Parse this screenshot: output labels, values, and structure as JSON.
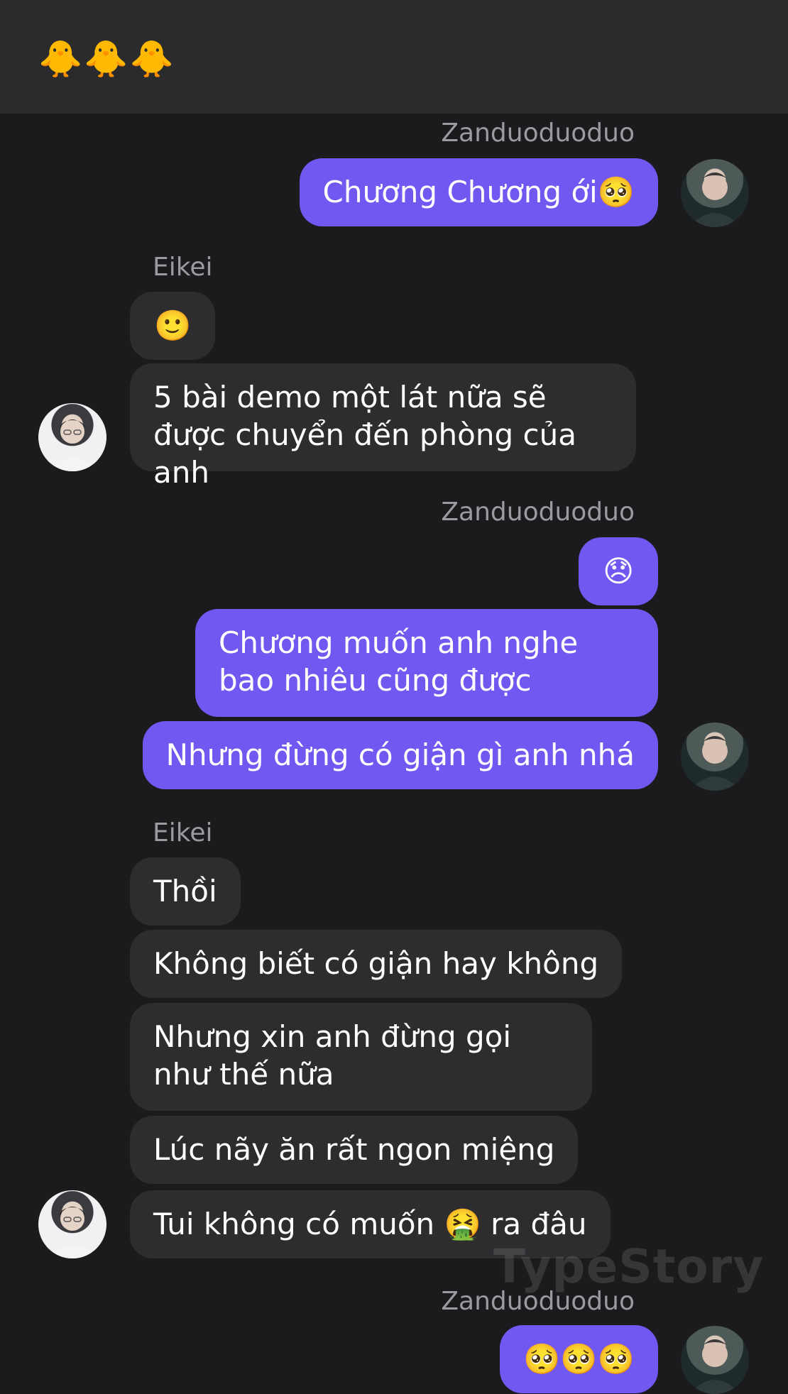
{
  "header": {
    "title": "🐥🐥🐥"
  },
  "messages": {
    "name_1": "Zanduoduoduo",
    "msg_1": "Chương Chương ới🥺",
    "name_2": "Eikei",
    "msg_2": "🙂",
    "msg_3": "5 bài demo một lát nữa sẽ được chuyển đến phòng của anh",
    "name_3": "Zanduoduoduo",
    "msg_4": "😞",
    "msg_5": "Chương muốn anh nghe bao nhiêu cũng được",
    "msg_6": "Nhưng đừng có giận gì anh nhá",
    "name_4": "Eikei",
    "msg_7": "Thồi",
    "msg_8": "Không biết có giận hay không",
    "msg_9": "Nhưng xin anh đừng gọi như thế nữa",
    "msg_10": "Lúc nãy ăn rất ngon miệng",
    "msg_11": "Tui không có muốn 🤮 ra đâu",
    "name_5": "Zanduoduoduo",
    "msg_12": "🥺🥺🥺"
  },
  "watermark": "TypeStory",
  "colors": {
    "background": "#1b1b1d",
    "header": "#2b2b2d",
    "outgoing_bubble": "#7158f0",
    "incoming_bubble": "#2d2d30",
    "sender_name": "#9a9a9f"
  },
  "icons": {
    "avatar_right": "avatar",
    "avatar_left": "avatar"
  }
}
